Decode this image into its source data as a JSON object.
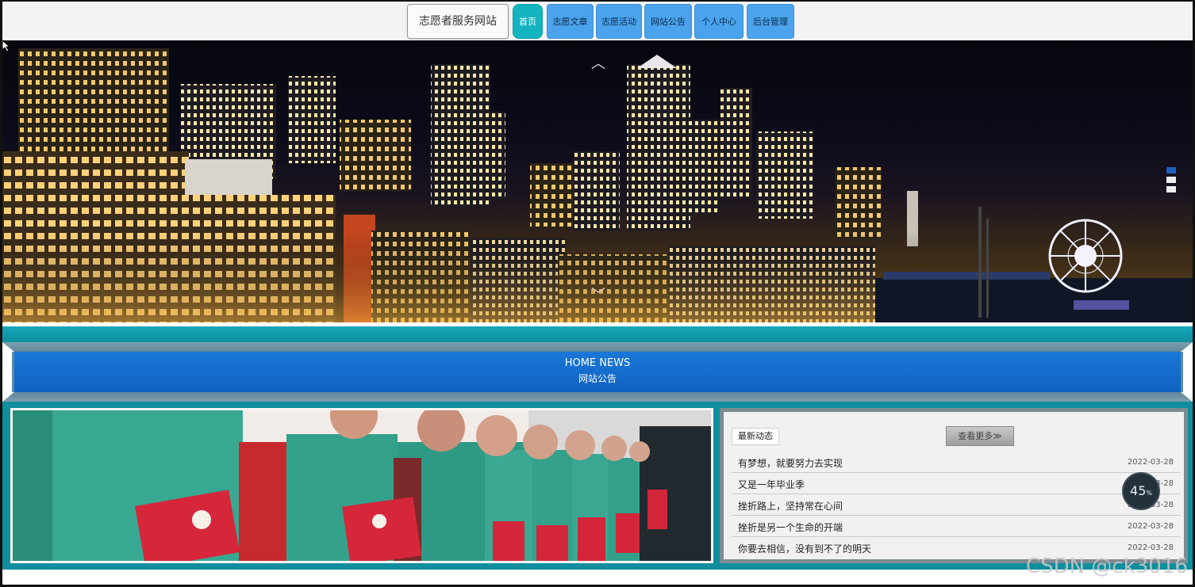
{
  "nav": {
    "site_title": "志愿者服务网站",
    "items": [
      {
        "label": "首页",
        "active": true
      },
      {
        "label": "志愿文章",
        "active": false
      },
      {
        "label": "志愿活动",
        "active": false
      },
      {
        "label": "网站公告",
        "active": false
      },
      {
        "label": "个人中心",
        "active": false
      },
      {
        "label": "后台管理",
        "active": false
      }
    ]
  },
  "hero": {
    "up_arrow": "︿",
    "down_arrow": "﹀",
    "slides": 3,
    "active_slide": 0
  },
  "section": {
    "title_en": "HOME NEWS",
    "title_cn": "网站公告"
  },
  "news": {
    "tab_label": "最新动态",
    "more_label": "查看更多≫",
    "items": [
      {
        "title": "有梦想，就要努力去实现",
        "date": "2022-03-28"
      },
      {
        "title": "又是一年毕业季",
        "date": "2022-03-28"
      },
      {
        "title": "挫折路上，坚持常在心间",
        "date": "2022-03-28"
      },
      {
        "title": "挫折是另一个生命的开端",
        "date": "2022-03-28"
      },
      {
        "title": "你要去相信，没有到不了的明天",
        "date": "2022-03-28"
      }
    ]
  },
  "zoom": {
    "value": "45",
    "unit": "%"
  },
  "watermark": "CSDN @ck3016",
  "colors": {
    "accent": "#13b3bf",
    "nav_button": "#4aa3ec",
    "band": "#0f62c2",
    "teal": "#0f8e9e"
  }
}
